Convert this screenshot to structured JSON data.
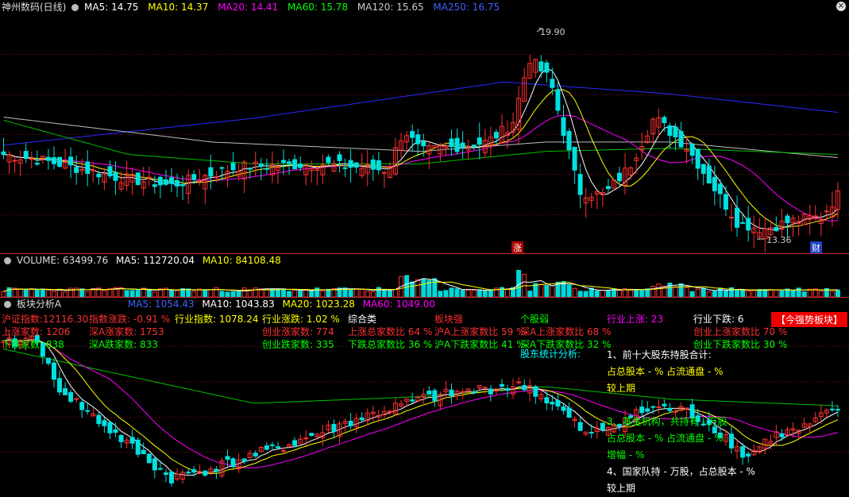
{
  "main": {
    "title": "神州数码(日线)",
    "ma": [
      {
        "label": "MA5: 14.75",
        "color": "#ffffff"
      },
      {
        "label": "MA10: 14.37",
        "color": "#ffff00"
      },
      {
        "label": "MA20: 14.41",
        "color": "#ff00ff"
      },
      {
        "label": "MA60: 15.78",
        "color": "#00ff00"
      },
      {
        "label": "MA120: 15.65",
        "color": "#cccccc"
      },
      {
        "label": "MA250: 16.75",
        "color": "#3030ff"
      }
    ],
    "high_label": "19.90",
    "low_label": "13.36",
    "badge_up": "涨",
    "badge_cai": "财"
  },
  "volume": {
    "label": "VOLUME: 63499.76",
    "ma5": "MA5: 112720.04",
    "ma10": "MA10: 84108.48"
  },
  "sector": {
    "title": "板块分析A",
    "ma": [
      {
        "label": "MA5: 1054.43",
        "color": "#3050ff"
      },
      {
        "label": "MA10: 1043.83",
        "color": "#ffffff"
      },
      {
        "label": "MA20: 1023.28",
        "color": "#ffff00"
      },
      {
        "label": "MA60: 1049.00",
        "color": "#ff00ff"
      }
    ],
    "badge": "【今强势板块】"
  },
  "info": {
    "c1": [
      {
        "text": "沪证指数:12116.30",
        "color": "#ff3030"
      },
      {
        "text": "上涨家数: 1206",
        "color": "#ff3030"
      },
      {
        "text": "下跌家数: 838",
        "color": "#00ff00"
      }
    ],
    "c2": [
      {
        "text": "指数涨跌: -0.91 %",
        "color": "#ff3030"
      },
      {
        "text": "深A涨家数: 1753",
        "color": "#ff3030"
      },
      {
        "text": "深A跌家数: 833",
        "color": "#00ff00"
      }
    ],
    "c3": [
      {
        "text": "行业指数: 1078.24",
        "color": "#ffff00"
      }
    ],
    "c4": [
      {
        "text": "行业涨跌: 1.02 %",
        "color": "#ffff00"
      },
      {
        "text": "创业涨家数: 774",
        "color": "#ff3030"
      },
      {
        "text": "创业跌家数: 335",
        "color": "#00ff00"
      }
    ],
    "c5": [
      {
        "text": "综合类",
        "color": "#ffffff"
      },
      {
        "text": "上涨总家数比 64 %",
        "color": "#ff3030"
      },
      {
        "text": "下跌总家数比 36 %",
        "color": "#00ff00"
      }
    ],
    "c6": [
      {
        "text": "板块强",
        "color": "#ff3030"
      },
      {
        "text": "沪A上涨家数比 59 %",
        "color": "#ff3030"
      },
      {
        "text": "沪A下跌家数比 41 %",
        "color": "#00ff00"
      }
    ],
    "c7": [
      {
        "text": "个股弱",
        "color": "#00ff00"
      },
      {
        "text": "深A上涨家数比 68 %",
        "color": "#ff3030"
      },
      {
        "text": "深A下跌家数比 32 %",
        "color": "#00ff00"
      }
    ],
    "c8": [
      {
        "text": "行业上涨: 23",
        "color": "#ff00ff"
      }
    ],
    "c9": [
      {
        "text": "行业下跌: 6",
        "color": "#ffffff"
      },
      {
        "text": "创业上涨家数比 70 %",
        "color": "#ff3030"
      },
      {
        "text": "创业下跌家数比 30 %",
        "color": "#00ff00"
      }
    ],
    "share": [
      {
        "text": "股东统计分析:",
        "color": "#00ffff"
      },
      {
        "text": "1、前十大股东持股合计:",
        "color": "#ffffff"
      },
      {
        "text": "占总股本 - %   占流通盘 - %",
        "color": "#ffff00"
      },
      {
        "text": "较上期",
        "color": "#ffff00"
      },
      {
        "text": "3、基金机构，共持有 - 万股",
        "color": "#00ff00"
      },
      {
        "text": "占总股本 - %   占流通盘 - %",
        "color": "#00ff00"
      },
      {
        "text": "增幅 - %",
        "color": "#00ff00"
      },
      {
        "text": "4、国家队持 - 万股，占总股本 - %",
        "color": "#ffffff"
      },
      {
        "text": "较上期",
        "color": "#ffffff"
      }
    ]
  }
}
